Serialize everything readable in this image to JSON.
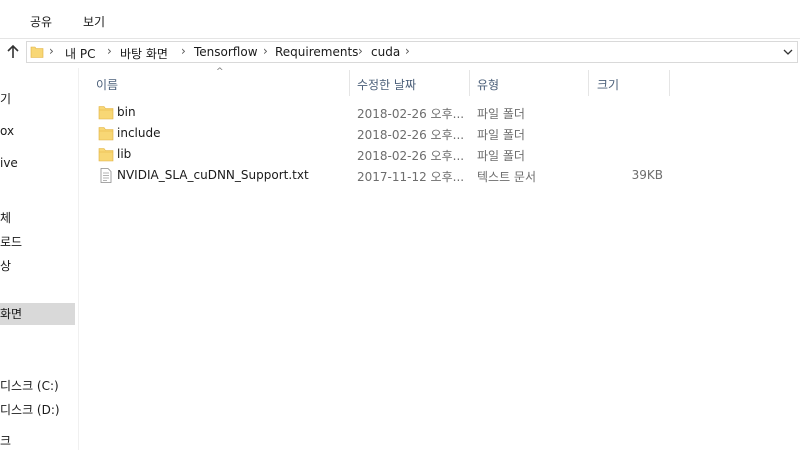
{
  "ribbon": {
    "tabs": [
      "공유",
      "보기"
    ]
  },
  "address": {
    "crumbs": [
      "내 PC",
      "바탕 화면",
      "Tensorflow",
      "Requirements",
      "cuda"
    ],
    "separator": "›"
  },
  "nav": {
    "items": [
      {
        "label": "기"
      },
      {
        "label": "ox"
      },
      {
        "label": "ive"
      },
      {
        "label": "체"
      },
      {
        "label": "로드"
      },
      {
        "label": "상"
      },
      {
        "label": "화면",
        "selected": true
      },
      {
        "label": "디스크 (C:)"
      },
      {
        "label": "디스크 (D:)"
      },
      {
        "label": "크"
      }
    ]
  },
  "columns": {
    "name": "이름",
    "date": "수정한 날짜",
    "type": "유형",
    "size": "크기"
  },
  "files": [
    {
      "name": "bin",
      "date": "2018-02-26 오후...",
      "type": "파일 폴더",
      "size": "",
      "icon": "folder-icon"
    },
    {
      "name": "include",
      "date": "2018-02-26 오후...",
      "type": "파일 폴더",
      "size": "",
      "icon": "folder-icon"
    },
    {
      "name": "lib",
      "date": "2018-02-26 오후...",
      "type": "파일 폴더",
      "size": "",
      "icon": "folder-icon"
    },
    {
      "name": "NVIDIA_SLA_cuDNN_Support.txt",
      "date": "2017-11-12 오후...",
      "type": "텍스트 문서",
      "size": "39KB",
      "icon": "text-file-icon"
    }
  ],
  "colors": {
    "folder": "#f8d775",
    "folder_dark": "#e8b84a",
    "selection": "#d9d9d9",
    "header_text": "#4c607a"
  }
}
